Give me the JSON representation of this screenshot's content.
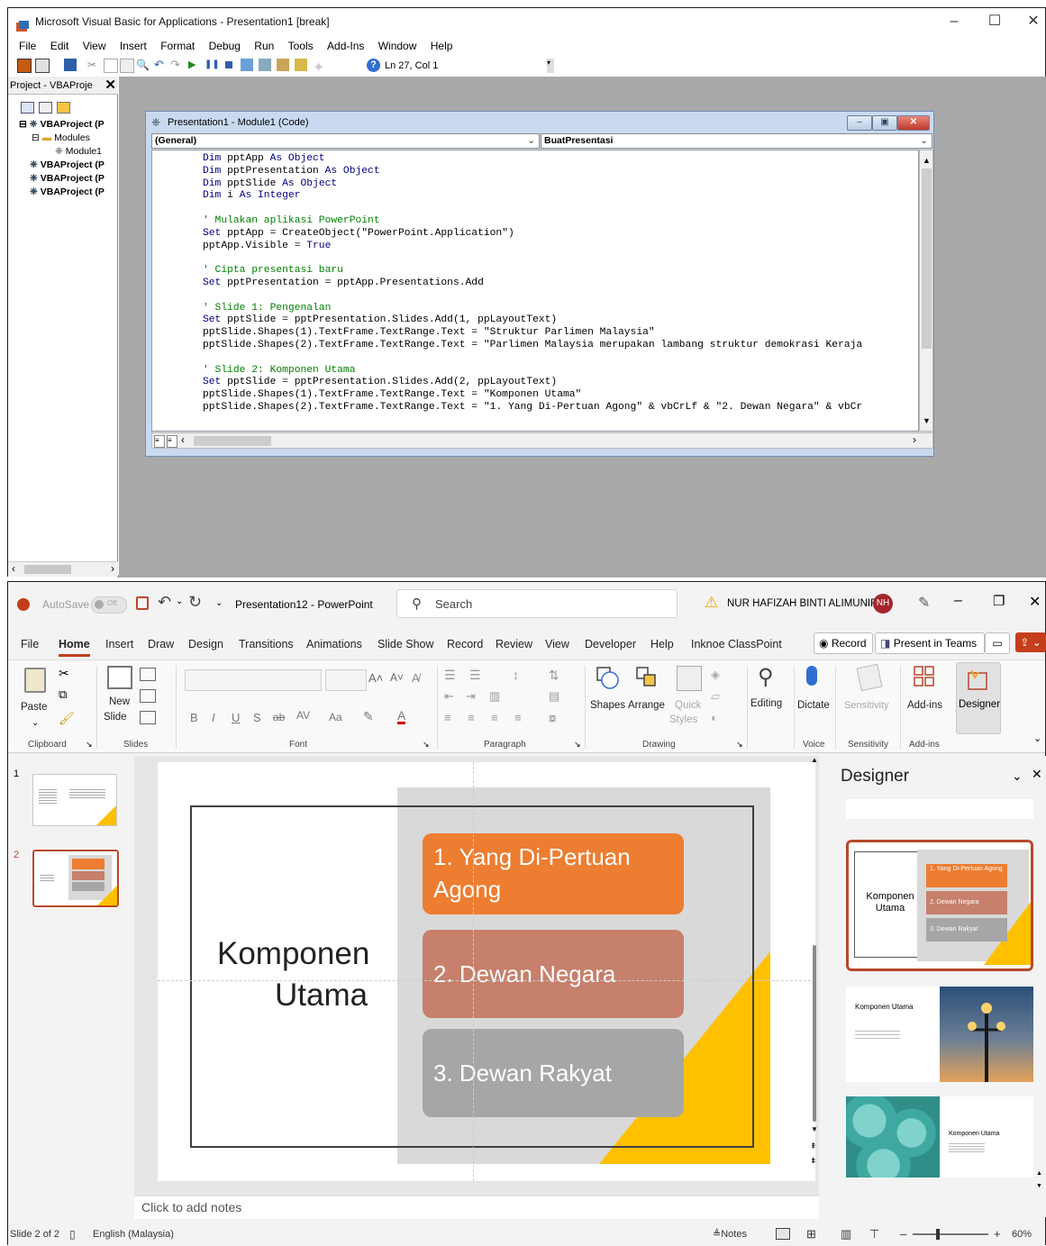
{
  "vba": {
    "title": "Microsoft Visual Basic for Applications - Presentation1 [break]",
    "menu": [
      "File",
      "Edit",
      "View",
      "Insert",
      "Format",
      "Debug",
      "Run",
      "Tools",
      "Add-Ins",
      "Window",
      "Help"
    ],
    "status_position": "Ln 27, Col 1",
    "project_pane": {
      "title": "Project - VBAProje",
      "tree": [
        "VBAProject (P",
        "Modules",
        "Module1",
        "VBAProject (P",
        "VBAProject (P",
        "VBAProject (P"
      ]
    },
    "code_window": {
      "title": "Presentation1 - Module1 (Code)",
      "object_combo": "(General)",
      "proc_combo": "BuatPresentasi"
    }
  },
  "ppt": {
    "autosave_label": "AutoSave",
    "autosave_state": "Off",
    "doc_title": "Presentation12 - PowerPoint",
    "search_placeholder": "Search",
    "user_name": "NUR HAFIZAH BINTI ALIMUNIR",
    "user_initials": "NH",
    "tabs": [
      "File",
      "Home",
      "Insert",
      "Draw",
      "Design",
      "Transitions",
      "Animations",
      "Slide Show",
      "Record",
      "Review",
      "View",
      "Developer",
      "Help",
      "Inknoe ClassPoint"
    ],
    "active_tab": "Home",
    "record_button": "Record",
    "present_teams_button": "Present in Teams",
    "ribbon": {
      "paste": "Paste",
      "new_slide": "New",
      "new_slide_2": "Slide",
      "shapes": "Shapes",
      "arrange": "Arrange",
      "quick_styles": "Quick",
      "quick_styles_2": "Styles",
      "editing": "Editing",
      "dictate": "Dictate",
      "sensitivity_btn": "Sensitivity",
      "addins_btn": "Add-ins",
      "designer_btn": "Designer",
      "group_clipboard": "Clipboard",
      "group_slides": "Slides",
      "group_font": "Font",
      "group_paragraph": "Paragraph",
      "group_drawing": "Drawing",
      "group_voice": "Voice",
      "group_sensitivity": "Sensitivity",
      "group_addins": "Add-ins"
    },
    "slide_numbers": [
      "1",
      "2"
    ],
    "slide": {
      "title_line1": "Komponen",
      "title_line2": "Utama",
      "items": [
        "1. Yang Di-Pertuan Agong",
        "2. Dewan Negara",
        "3. Dewan Rakyat"
      ]
    },
    "notes_placeholder": "Click to add notes",
    "designer": {
      "title": "Designer",
      "idea1_title": "Komponen Utama",
      "idea2_title": "Komponen Utama",
      "idea3_title": "Komponen Utama"
    },
    "status": {
      "slide_info": "Slide 2 of 2",
      "language": "English (Malaysia)",
      "notes": "Notes",
      "zoom": "60%"
    },
    "colors": {
      "accent_red": "#b7472a",
      "orange": "#ed7d31",
      "terracotta": "#c6806c",
      "gray_box": "#a6a6a6",
      "yellow": "#ffc000"
    }
  }
}
